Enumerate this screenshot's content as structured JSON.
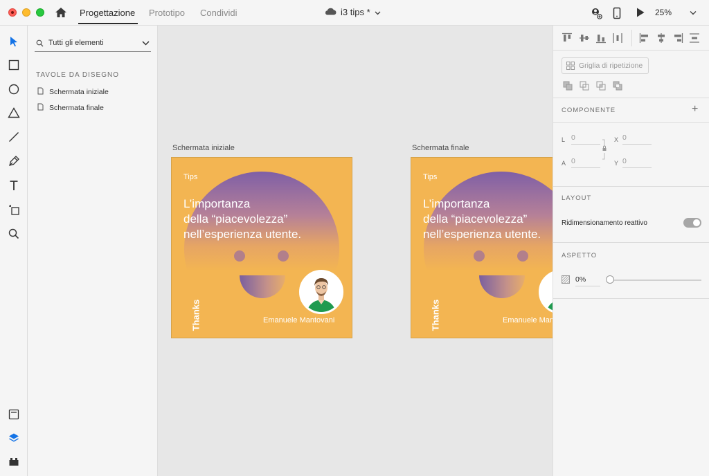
{
  "titlebar": {
    "tabs": [
      {
        "label": "Progettazione",
        "active": true
      },
      {
        "label": "Prototipo",
        "active": false
      },
      {
        "label": "Condividi",
        "active": false
      }
    ],
    "doc_title": "i3 tips *",
    "zoom": "25%"
  },
  "layers": {
    "filter_label": "Tutti gli elementi",
    "section_label": "TAVOLE DA DISEGNO",
    "artboards": [
      "Schermata iniziale",
      "Schermata finale"
    ]
  },
  "canvas": {
    "artboards": [
      {
        "label": "Schermata iniziale",
        "tips": "Tips",
        "headline_line1": "L’importanza",
        "headline_line2": "della “piacevolezza”",
        "headline_line3": "nell’esperienza utente.",
        "thanks": "Thanks",
        "author": "Emanuele Mantovani"
      },
      {
        "label": "Schermata finale",
        "tips": "Tips",
        "headline_line1": "L’importanza",
        "headline_line2": "della “piacevolezza”",
        "headline_line3": "nell’esperienza utente.",
        "thanks": "Thanks",
        "author": "Emanuele Mantovani"
      }
    ],
    "colors": {
      "artboard_bg": "#f3b552",
      "gradient_top": "#7f5fa6"
    }
  },
  "inspector": {
    "repeat_grid_label": "Griglia di ripetizione",
    "component_header": "COMPONENTE",
    "fields": {
      "w_label": "L",
      "w_value": "0",
      "h_label": "A",
      "h_value": "0",
      "x_label": "X",
      "x_value": "0",
      "y_label": "Y",
      "y_value": "0"
    },
    "layout_header": "LAYOUT",
    "responsive_label": "Ridimensionamento reattivo",
    "appearance_header": "ASPETTO",
    "opacity_value": "0%"
  }
}
